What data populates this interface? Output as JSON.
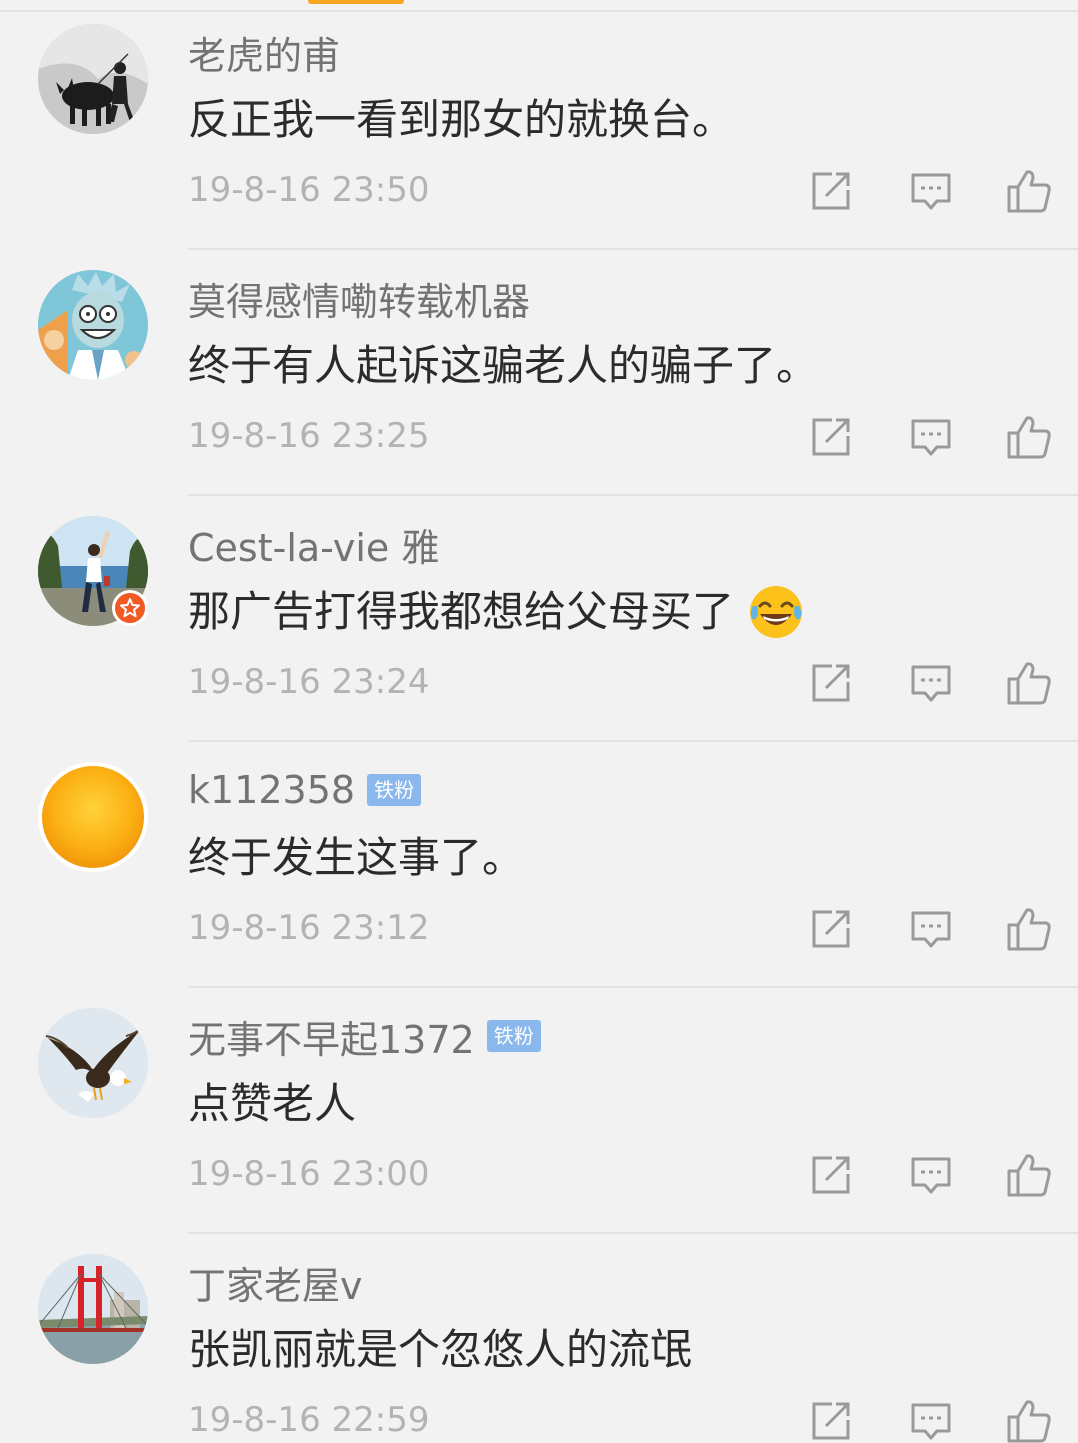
{
  "comments": [
    {
      "username": "老虎的甫",
      "fan_badge": "",
      "verified": false,
      "text": "反正我一看到那女的就换台。",
      "emoji": "",
      "time": "19-8-16 23:50",
      "avatar_icon": "bull-rider-photo-icon"
    },
    {
      "username": "莫得感情嘞转载机器",
      "fan_badge": "",
      "verified": false,
      "text": "终于有人起诉这骗老人的骗子了。",
      "emoji": "",
      "time": "19-8-16 23:25",
      "avatar_icon": "cartoon-scientist-icon"
    },
    {
      "username": "Cest-la-vie 雅",
      "fan_badge": "",
      "verified": true,
      "text": "那广告打得我都想给父母买了",
      "emoji": "laughing-tears-emoji",
      "time": "19-8-16 23:24",
      "avatar_icon": "woman-seaside-photo-icon"
    },
    {
      "username": "k112358",
      "fan_badge": "铁粉",
      "verified": false,
      "text": "终于发生这事了。",
      "emoji": "",
      "time": "19-8-16 23:12",
      "avatar_icon": "orange-sun-icon"
    },
    {
      "username": "无事不早起1372",
      "fan_badge": "铁粉",
      "verified": false,
      "text": "点赞老人",
      "emoji": "",
      "time": "19-8-16 23:00",
      "avatar_icon": "eagle-photo-icon"
    },
    {
      "username": "丁家老屋v",
      "fan_badge": "",
      "verified": false,
      "text": "张凯丽就是个忽悠人的流氓",
      "emoji": "",
      "time": "19-8-16 22:59",
      "avatar_icon": "red-bridge-photo-icon"
    }
  ],
  "colors": {
    "background": "#f2f2f2",
    "username": "#737373",
    "text": "#2b2b2b",
    "timestamp": "#b3b3b3",
    "fan_badge": "#8ab7ec",
    "verified_badge": "#f15a22",
    "icon": "#9a9a9a"
  }
}
